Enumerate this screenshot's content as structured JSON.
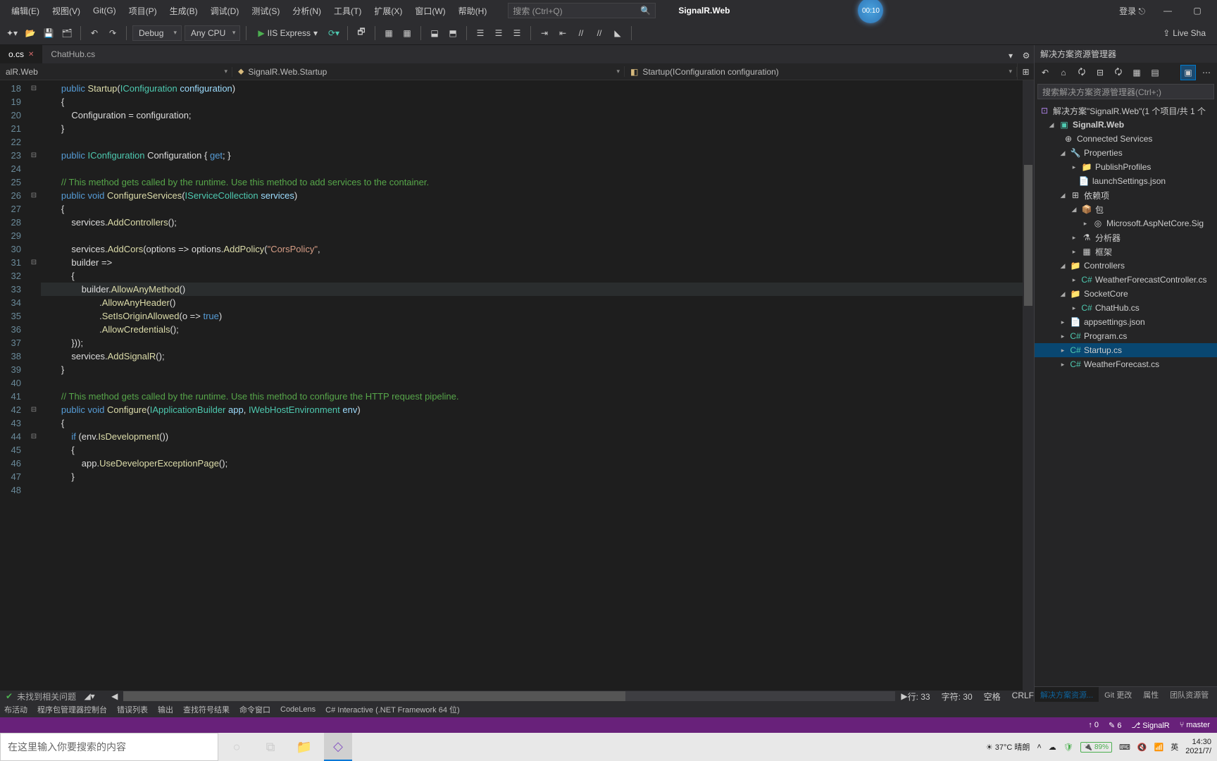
{
  "menu": {
    "items": [
      "编辑(E)",
      "视图(V)",
      "Git(G)",
      "项目(P)",
      "生成(B)",
      "调试(D)",
      "测试(S)",
      "分析(N)",
      "工具(T)",
      "扩展(X)",
      "窗口(W)",
      "帮助(H)"
    ]
  },
  "search": {
    "placeholder": "搜索 (Ctrl+Q)"
  },
  "app_title": "SignalR.Web",
  "rec_timer": "00:10",
  "login": "登录",
  "toolbar": {
    "config": "Debug",
    "platform": "Any CPU",
    "run": "IIS Express",
    "liveshare": "Live Sha"
  },
  "tabs": {
    "t1": "o.cs",
    "t2": "ChatHub.cs"
  },
  "nav": {
    "a": "alR.Web",
    "b": "SignalR.Web.Startup",
    "c": "Startup(IConfiguration configuration)"
  },
  "gutter": [
    "18",
    "19",
    "20",
    "21",
    "22",
    "23",
    "24",
    "25",
    "26",
    "27",
    "28",
    "29",
    "30",
    "31",
    "32",
    "33",
    "34",
    "35",
    "36",
    "37",
    "38",
    "39",
    "40",
    "41",
    "42",
    "43",
    "44",
    "45",
    "46",
    "47",
    "48"
  ],
  "fold": [
    "⊟",
    "",
    "",
    "",
    "",
    "⊟",
    "",
    "",
    "⊟",
    "",
    "",
    "",
    "",
    "⊟",
    "",
    "",
    "",
    "",
    "",
    "",
    "",
    "",
    "",
    "",
    "⊟",
    "",
    "⊟",
    "",
    "",
    "",
    ""
  ],
  "sol": {
    "title": "解决方案资源管理器",
    "search_ph": "搜索解决方案资源管理器(Ctrl+;)",
    "root": "解决方案\"SignalR.Web\"(1 个项目/共 1 个",
    "proj": "SignalR.Web",
    "connected": "Connected Services",
    "props": "Properties",
    "pub": "PublishProfiles",
    "launch": "launchSettings.json",
    "deps": "依赖项",
    "pkg": "包",
    "nuget1": "Microsoft.AspNetCore.Sig",
    "analyzer": "分析器",
    "framework": "框架",
    "controllers": "Controllers",
    "weatherctrl": "WeatherForecastController.cs",
    "socket": "SocketCore",
    "chathub": "ChatHub.cs",
    "appset": "appsettings.json",
    "program": "Program.cs",
    "startup": "Startup.cs",
    "weather": "WeatherForecast.cs",
    "tabs": {
      "se": "解决方案资源...",
      "git": "Git 更改",
      "prop": "属性",
      "team": "团队资源管"
    }
  },
  "status2": {
    "issue": "未找到相关问题",
    "ln": "行: 33",
    "ch": "字符: 30",
    "spc": "空格",
    "le": "CRLF"
  },
  "panel_tabs": [
    "布活动",
    "程序包管理器控制台",
    "错误列表",
    "输出",
    "查找符号结果",
    "命令窗口",
    "CodeLens",
    "C# Interactive (.NET Framework 64 位)"
  ],
  "vsstatus": {
    "up": "0",
    "edit": "6",
    "repo": "SignalR",
    "branch": "master"
  },
  "taskbar": {
    "search": "在这里输入你要搜索的内容",
    "weather": "37°C 晴朗",
    "ime": "英",
    "battery": "89%",
    "time": "14:30",
    "date": "2021/7/"
  }
}
